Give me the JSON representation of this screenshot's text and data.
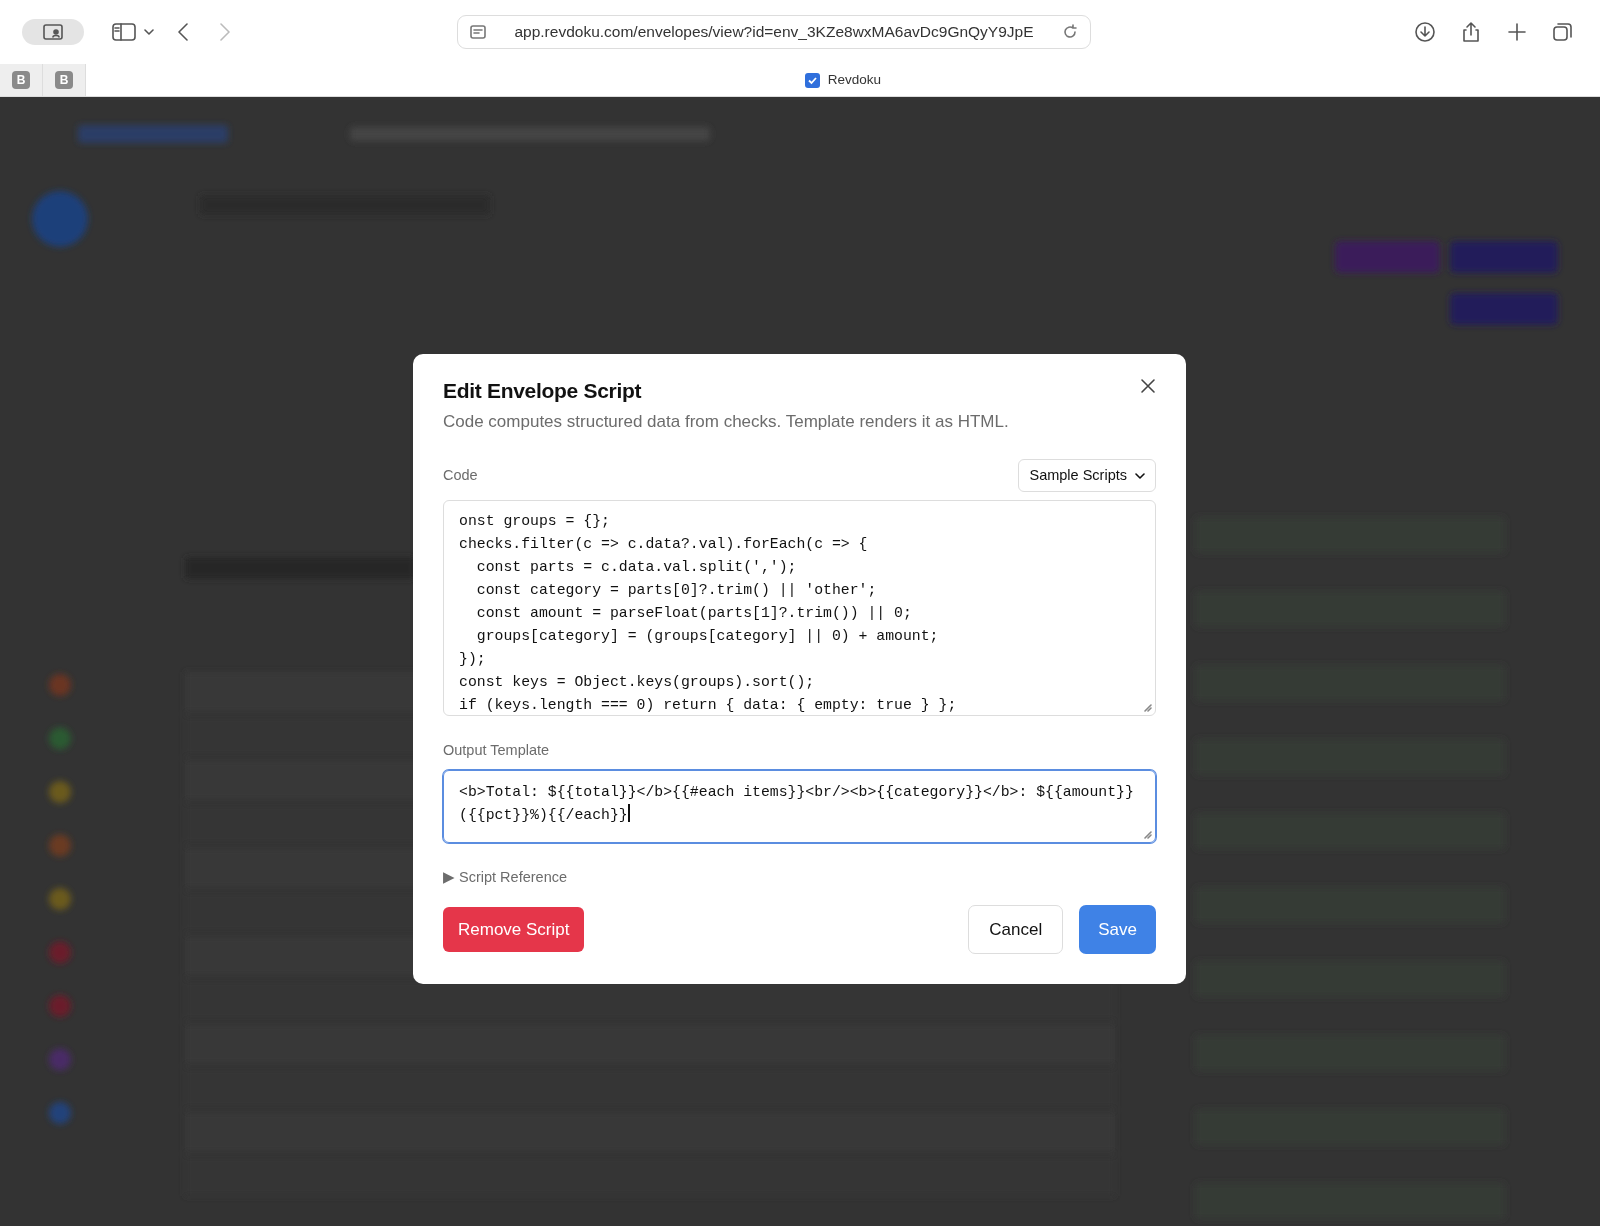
{
  "browser": {
    "url": "app.revdoku.com/envelopes/view?id=env_3KZe8wxMA6avDc9GnQyY9JpE",
    "back_disabled": false,
    "forward_disabled": true,
    "tabs": [
      {
        "kind": "pinned",
        "label": "B",
        "selected": false
      },
      {
        "kind": "pinned",
        "label": "B",
        "selected": false
      },
      {
        "kind": "page",
        "label": "Revdoku",
        "selected": true
      }
    ]
  },
  "backdrop": {
    "kind": "blurred-page"
  },
  "dialog": {
    "title": "Edit Envelope Script",
    "subtitle": "Code computes structured data from checks. Template renders it as HTML.",
    "code_label": "Code",
    "samples_button": "Sample Scripts",
    "code_lines": [
      "onst groups = {};",
      "checks.filter(c => c.data?.val).forEach(c => {",
      "  const parts = c.data.val.split(',');",
      "  const category = parts[0]?.trim() || 'other';",
      "  const amount = parseFloat(parts[1]?.trim()) || 0;",
      "  groups[category] = (groups[category] || 0) + amount;",
      "});",
      "const keys = Object.keys(groups).sort();",
      "if (keys.length === 0) return { data: { empty: true } };"
    ],
    "template_label": "Output Template",
    "template": {
      "value": "<b>Total: ${{total}}</b>{{#each items}}<br/><b>{{category}}</b>: ${{amount}} ({{pct}}%){{/each}}",
      "focused": true
    },
    "reference": {
      "marker": "▶",
      "label": "Script Reference",
      "expanded": false
    },
    "buttons": [
      {
        "kind": "danger",
        "label": "Remove Script"
      },
      {
        "kind": "secondary",
        "label": "Cancel"
      },
      {
        "kind": "primary",
        "label": "Save"
      }
    ]
  }
}
